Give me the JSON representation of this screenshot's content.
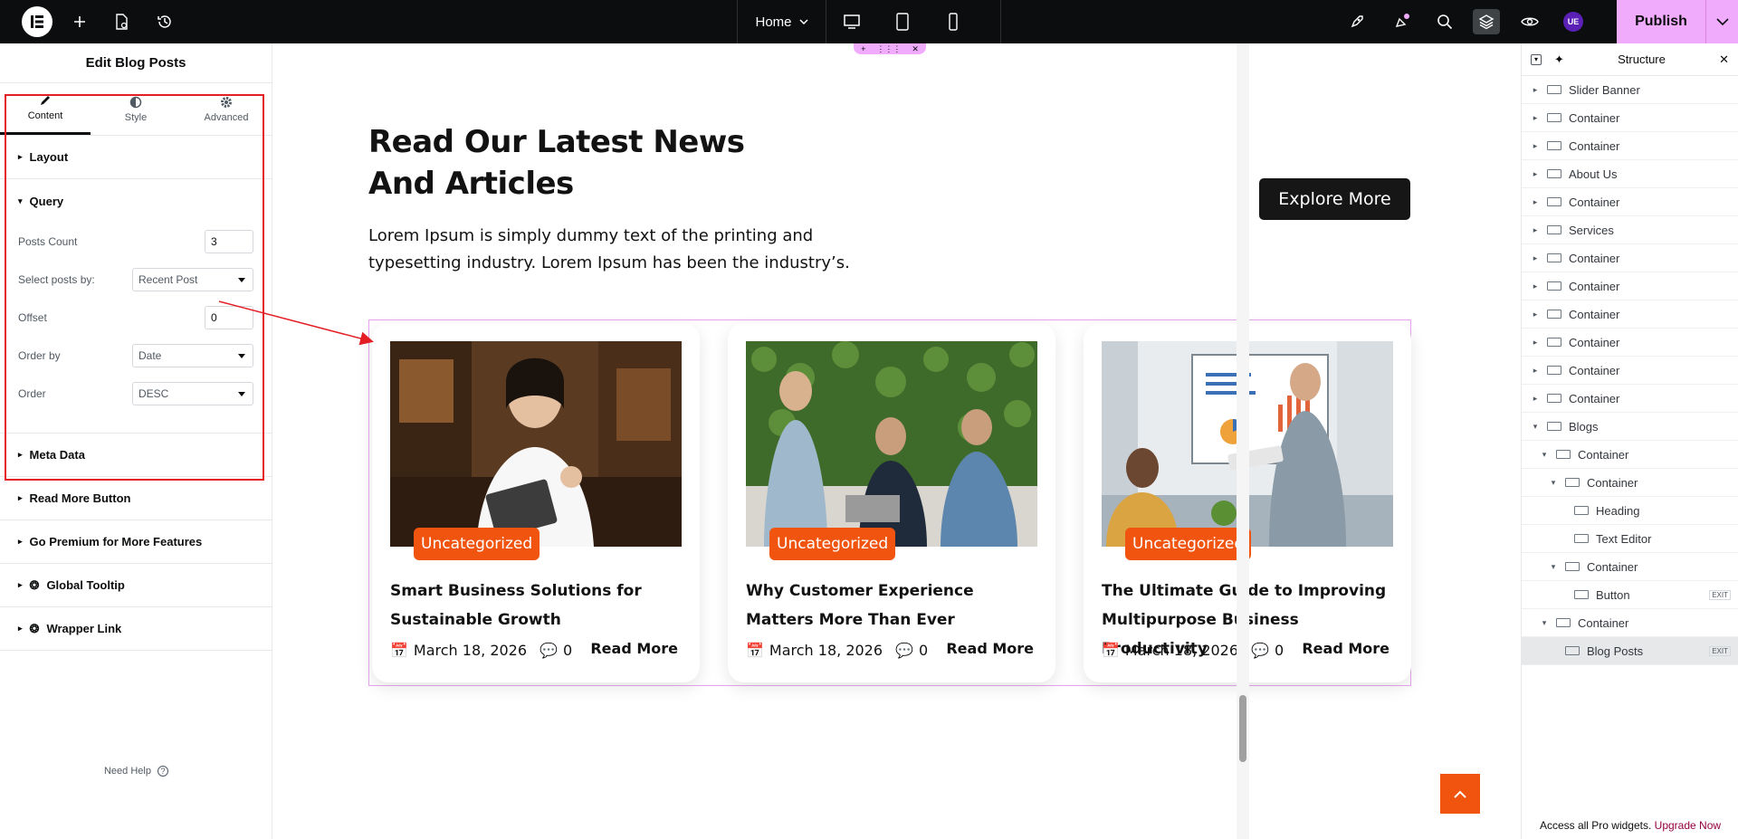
{
  "topbar": {
    "page_selector": "Home",
    "publish_label": "Publish",
    "user_initials": "UE"
  },
  "left_panel": {
    "title": "Edit Blog Posts",
    "tabs": [
      {
        "label": "Content",
        "icon": "pencil-icon"
      },
      {
        "label": "Style",
        "icon": "half-circle-icon"
      },
      {
        "label": "Advanced",
        "icon": "gear-icon"
      }
    ],
    "sections_top": [
      {
        "label": "Layout"
      },
      {
        "label": "Query"
      }
    ],
    "controls": {
      "posts_count": {
        "label": "Posts Count",
        "value": "3"
      },
      "select_posts_by": {
        "label": "Select posts by:",
        "value": "Recent Post"
      },
      "offset": {
        "label": "Offset",
        "value": "0"
      },
      "order_by": {
        "label": "Order by",
        "value": "Date"
      },
      "order": {
        "label": "Order",
        "value": "DESC"
      }
    },
    "sections_bottom": [
      {
        "label": "Meta Data"
      },
      {
        "label": "Read More Button"
      },
      {
        "label": "Go Premium for More Features"
      },
      {
        "label": "Global Tooltip"
      },
      {
        "label": "Wrapper Link"
      }
    ],
    "need_help": "Need Help"
  },
  "canvas": {
    "heading": "Read Our Latest News And Articles",
    "lead": "Lorem Ipsum is simply dummy text of the printing and typesetting industry. Lorem Ipsum has been the industry’s.",
    "explore_label": "Explore More",
    "posts": [
      {
        "category": "Uncategorized",
        "title": "Smart Business Solutions for Sustainable Growth",
        "date": "March 18, 2026",
        "comments": "0",
        "read_more": "Read More"
      },
      {
        "category": "Uncategorized",
        "title": "Why Customer Experience Matters More Than Ever",
        "date": "March 18, 2026",
        "comments": "0",
        "read_more": "Read More"
      },
      {
        "category": "Uncategorized",
        "title": "The Ultimate Guide to Improving Multipurpose Business Productivity",
        "date": "March 18, 2026",
        "comments": "0",
        "read_more": "Read More"
      }
    ]
  },
  "structure": {
    "title": "Structure",
    "items": [
      {
        "label": "Slider Banner",
        "depth": 0,
        "caret": "right"
      },
      {
        "label": "Container",
        "depth": 0,
        "caret": "right"
      },
      {
        "label": "Container",
        "depth": 0,
        "caret": "right"
      },
      {
        "label": "About Us",
        "depth": 0,
        "caret": "right"
      },
      {
        "label": "Container",
        "depth": 0,
        "caret": "right"
      },
      {
        "label": "Services",
        "depth": 0,
        "caret": "right"
      },
      {
        "label": "Container",
        "depth": 0,
        "caret": "right"
      },
      {
        "label": "Container",
        "depth": 0,
        "caret": "right"
      },
      {
        "label": "Container",
        "depth": 0,
        "caret": "right"
      },
      {
        "label": "Container",
        "depth": 0,
        "caret": "right"
      },
      {
        "label": "Container",
        "depth": 0,
        "caret": "right"
      },
      {
        "label": "Container",
        "depth": 0,
        "caret": "right"
      },
      {
        "label": "Blogs",
        "depth": 0,
        "caret": "down"
      },
      {
        "label": "Container",
        "depth": 1,
        "caret": "down"
      },
      {
        "label": "Container",
        "depth": 2,
        "caret": "down"
      },
      {
        "label": "Heading",
        "depth": 3,
        "caret": "none"
      },
      {
        "label": "Text Editor",
        "depth": 3,
        "caret": "none"
      },
      {
        "label": "Container",
        "depth": 2,
        "caret": "down"
      },
      {
        "label": "Button",
        "depth": 3,
        "caret": "none",
        "badge": "EXIT"
      },
      {
        "label": "Container",
        "depth": 1,
        "caret": "down"
      },
      {
        "label": "Blog Posts",
        "depth": 2,
        "caret": "none",
        "badge": "EXIT",
        "active": true
      }
    ],
    "footer_text": "Access all Pro widgets.",
    "footer_link": "Upgrade Now"
  },
  "colors": {
    "accent_pink": "#f0abfc",
    "orange": "#f0540f",
    "highlight_red": "#e31e24"
  }
}
